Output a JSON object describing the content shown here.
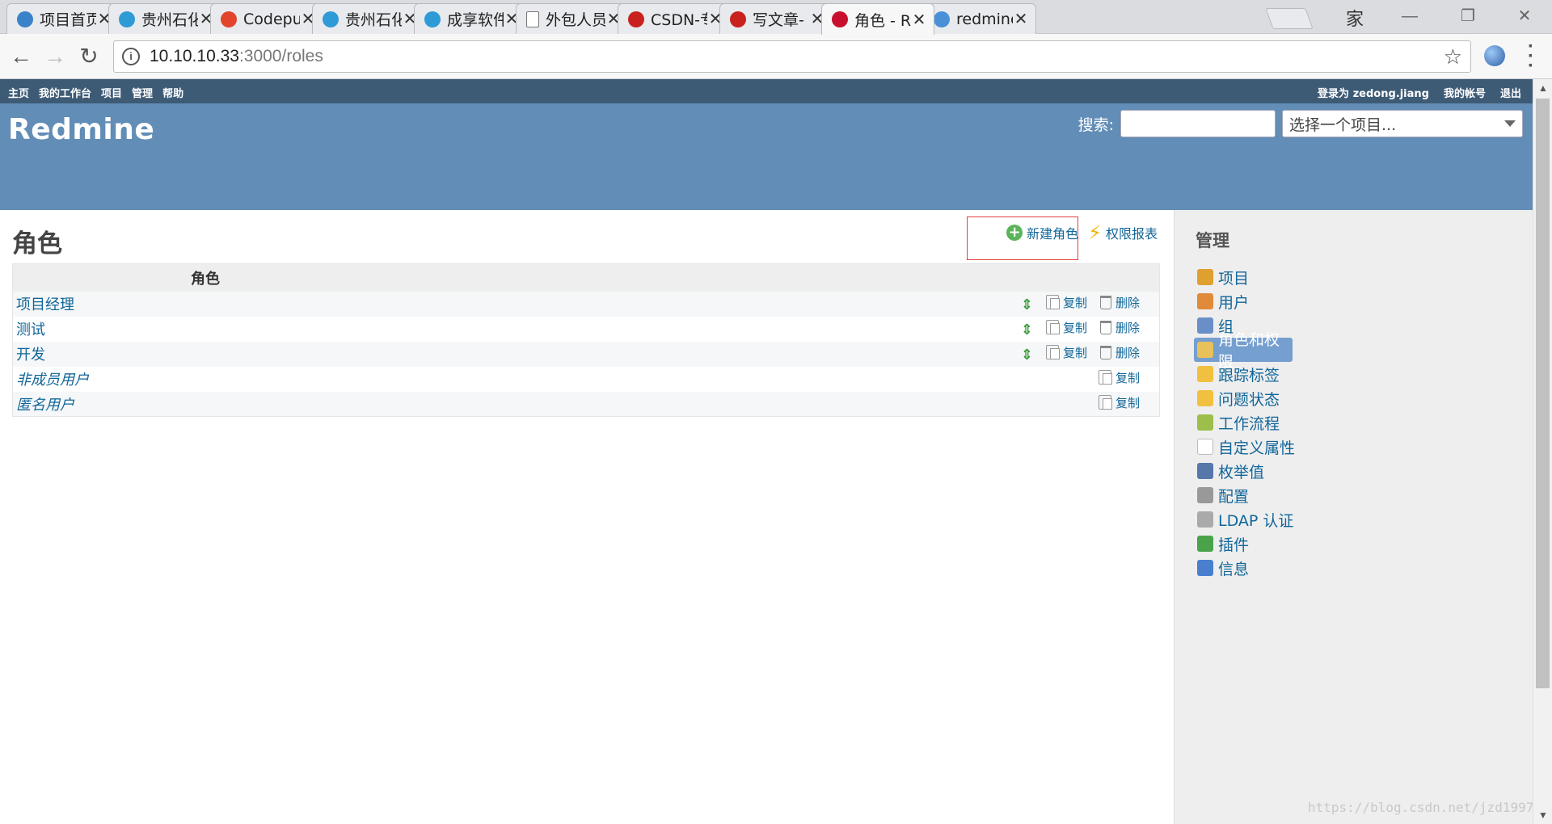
{
  "browser": {
    "tabs": [
      {
        "title": "项目首页",
        "fav_color": "#3b83c9"
      },
      {
        "title": "贵州石化",
        "fav_color": "#2e9bd6"
      },
      {
        "title": "Codepu",
        "fav_color": "#e2432a"
      },
      {
        "title": "贵州石化",
        "fav_color": "#2e9bd6"
      },
      {
        "title": "成享软件",
        "fav_color": "#2e9bd6"
      },
      {
        "title": "外包人员",
        "fav_color": "#ffffff"
      },
      {
        "title": "CSDN-专",
        "fav_color": "#c9211e"
      },
      {
        "title": "写文章-",
        "fav_color": "#c9211e"
      },
      {
        "title": "角色 - R",
        "fav_color": "#c8102e"
      },
      {
        "title": "redmine",
        "fav_color": "#4a90d9"
      }
    ],
    "active_tab_index": 8,
    "close_glyph": "✕",
    "profile_label": "家",
    "url_host": "10.10.10.33",
    "url_path": ":3000/roles"
  },
  "topmenu": {
    "left": [
      "主页",
      "我的工作台",
      "项目",
      "管理",
      "帮助"
    ],
    "logged_in_as": "登录为",
    "user": "zedong.jiang",
    "my_account": "我的帐号",
    "logout": "退出"
  },
  "header": {
    "title": "Redmine",
    "search_label": "搜索:",
    "search_value": "",
    "project_jump": "选择一个项目..."
  },
  "content": {
    "title": "角色",
    "new_role": "新建角色",
    "permissions_report": "权限报表",
    "table_header": "角色",
    "copy_label": "复制",
    "delete_label": "删除",
    "roles": [
      {
        "name": "项目经理",
        "builtin": false
      },
      {
        "name": "测试",
        "builtin": false
      },
      {
        "name": "开发",
        "builtin": false
      },
      {
        "name": "非成员用户",
        "builtin": true
      },
      {
        "name": "匿名用户",
        "builtin": true
      }
    ]
  },
  "sidebar": {
    "title": "管理",
    "items": [
      {
        "label": "项目",
        "icon": "projects-icon",
        "color": "#e0a030"
      },
      {
        "label": "用户",
        "icon": "user-icon",
        "color": "#e08a3a"
      },
      {
        "label": "组",
        "icon": "group-icon",
        "color": "#6a8fc8"
      },
      {
        "label": "角色和权限",
        "icon": "roles-icon",
        "color": "#e8c15a",
        "selected": true
      },
      {
        "label": "跟踪标签",
        "icon": "trackers-icon",
        "color": "#f0c040"
      },
      {
        "label": "问题状态",
        "icon": "issue-status-icon",
        "color": "#f0c040"
      },
      {
        "label": "工作流程",
        "icon": "workflow-icon",
        "color": "#9bbf4a"
      },
      {
        "label": "自定义属性",
        "icon": "custom-fields-icon",
        "color": "#ffffff"
      },
      {
        "label": "枚举值",
        "icon": "enumerations-icon",
        "color": "#5577aa"
      },
      {
        "label": "配置",
        "icon": "settings-icon",
        "color": "#999999"
      },
      {
        "label": "LDAP 认证",
        "icon": "ldap-icon",
        "color": "#aaaaaa"
      },
      {
        "label": "插件",
        "icon": "plugins-icon",
        "color": "#4aa34a"
      },
      {
        "label": "信息",
        "icon": "info-icon",
        "color": "#4a7fd0"
      }
    ]
  },
  "watermark": "https://blog.csdn.net/jzd1997"
}
